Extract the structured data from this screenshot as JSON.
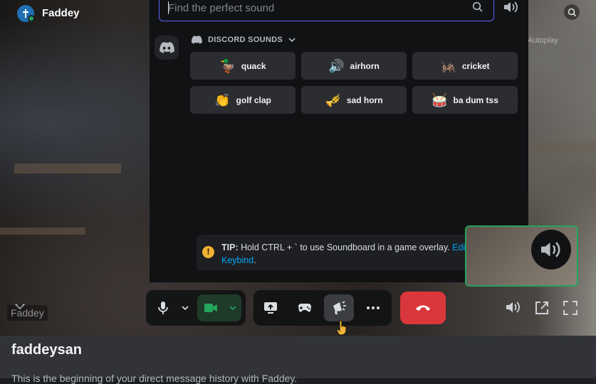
{
  "topbar": {
    "channel_name": "Faddey",
    "autoplay_hint": "Autoplay"
  },
  "soundboard": {
    "search_placeholder": "Find the perfect sound",
    "search_value": "",
    "section_title": "DISCORD SOUNDS",
    "sounds": [
      {
        "emoji": "🦆",
        "label": "quack"
      },
      {
        "emoji": "🔊",
        "label": "airhorn"
      },
      {
        "emoji": "🦗",
        "label": "cricket"
      },
      {
        "emoji": "👏",
        "label": "golf clap"
      },
      {
        "emoji": "🎺",
        "label": "sad horn"
      },
      {
        "emoji": "🥁",
        "label": "ba dum tss"
      }
    ],
    "tip": {
      "prefix": "TIP:",
      "text": " Hold CTRL + ` to use Soundboard in a game overlay. ",
      "link": "Edit Keybind",
      "suffix": "."
    }
  },
  "stage": {
    "user_tag": "Faddey"
  },
  "colors": {
    "accent": "#5865f2",
    "online": "#23a55a",
    "hangup": "#da373c",
    "link": "#00a8fc",
    "warning": "#f0b232"
  },
  "below": {
    "title": "faddeysan",
    "subtitle": "This is the beginning of your direct message history with Faddey."
  }
}
